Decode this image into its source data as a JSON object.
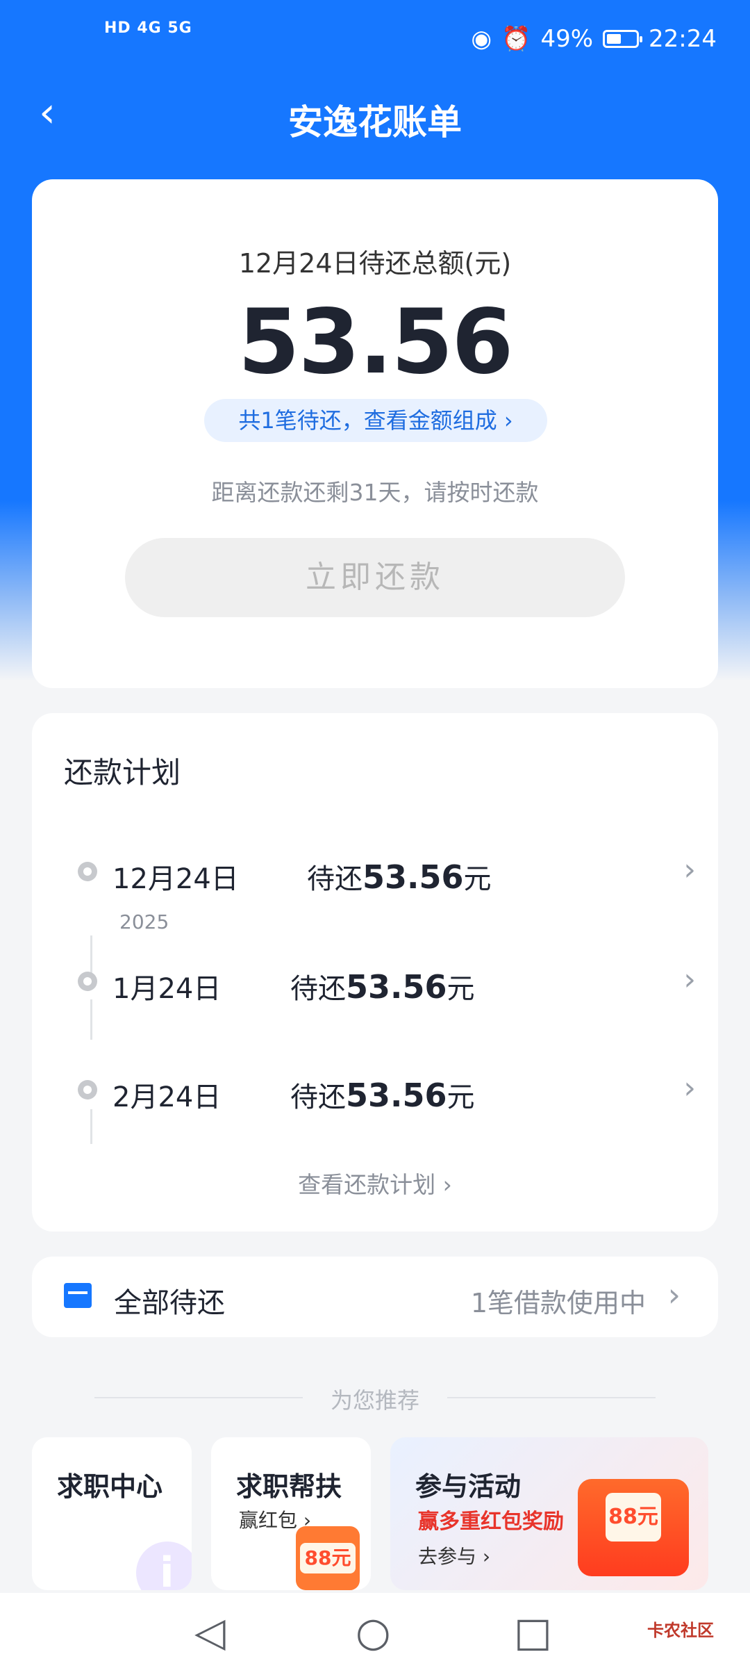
{
  "status_bar": {
    "signal": "HD 4G 5G",
    "battery": "49%",
    "battery_level": 0.49,
    "time": "22:24"
  },
  "nav": {
    "back_icon": "‹",
    "title": "安逸花账单"
  },
  "summary": {
    "due_label": "12月24日待还总额(元)",
    "amount": "53.56",
    "detail_link": "共1笔待还，查看金额组成 ›",
    "countdown": "距离还款还剩31天，请按时还款",
    "pay_button": "立即还款"
  },
  "plan": {
    "heading": "还款计划",
    "year_label": "2025",
    "items": [
      {
        "date": "12月24日",
        "prefix": "待还",
        "amount": "53.56",
        "unit": "元"
      },
      {
        "date": "1月24日",
        "prefix": "待还",
        "amount": "53.56",
        "unit": "元"
      },
      {
        "date": "2月24日",
        "prefix": "待还",
        "amount": "53.56",
        "unit": "元"
      }
    ],
    "view_more": "查看还款计划 ›"
  },
  "all_due": {
    "label": "全部待还",
    "status": "1笔借款使用中"
  },
  "recommend": {
    "heading": "为您推荐",
    "tiles": [
      {
        "title": "求职中心"
      },
      {
        "title": "求职帮扶",
        "subtitle": "赢红包 ›",
        "badge": "88元"
      },
      {
        "title": "参与活动",
        "subtitle": "赢多重红包奖励",
        "cta": "去参与 ›",
        "badge": "88元"
      }
    ]
  },
  "bottom_nav": {
    "back": "◁",
    "home": "○",
    "recent": "□",
    "watermark": "卡农社区"
  }
}
